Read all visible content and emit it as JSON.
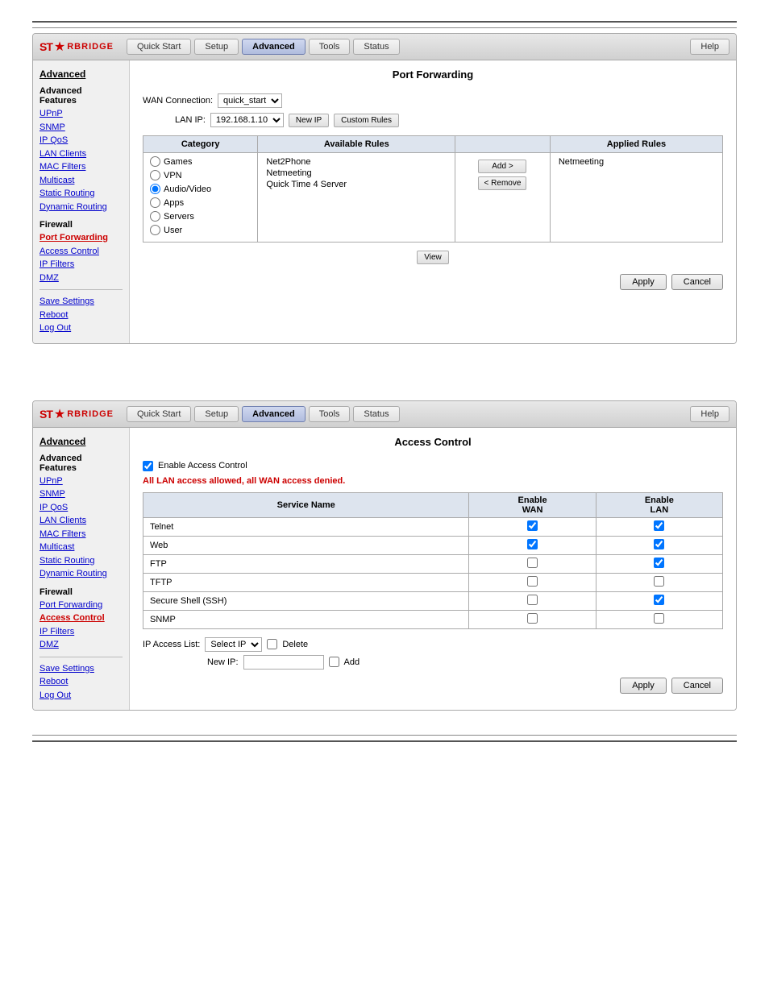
{
  "page": {
    "top_hr": true,
    "bottom_hr": true
  },
  "panel1": {
    "nav": {
      "logo_prefix": "ST",
      "logo_star": "★",
      "logo_suffix": "RBRIDGE",
      "buttons": [
        {
          "label": "Quick Start",
          "active": false
        },
        {
          "label": "Setup",
          "active": false
        },
        {
          "label": "Advanced",
          "active": true
        },
        {
          "label": "Tools",
          "active": false
        },
        {
          "label": "Status",
          "active": false
        },
        {
          "label": "Help",
          "active": false
        }
      ]
    },
    "sidebar": {
      "title": "Advanced",
      "sections": [
        {
          "title": "Advanced Features",
          "links": [
            {
              "label": "UPnP",
              "active": false
            },
            {
              "label": "SNMP",
              "active": false
            },
            {
              "label": "IP QoS",
              "active": false
            },
            {
              "label": "LAN Clients",
              "active": false
            },
            {
              "label": "MAC Filters",
              "active": false
            },
            {
              "label": "Multicast",
              "active": false
            },
            {
              "label": "Static Routing",
              "active": false
            },
            {
              "label": "Dynamic Routing",
              "active": false
            }
          ]
        },
        {
          "title": "Firewall",
          "links": [
            {
              "label": "Port Forwarding",
              "active": true
            },
            {
              "label": "Access Control",
              "active": false
            },
            {
              "label": "IP Filters",
              "active": false
            },
            {
              "label": "DMZ",
              "active": false
            }
          ]
        },
        {
          "title": "",
          "links": [
            {
              "label": "Save Settings",
              "active": false
            },
            {
              "label": "Reboot",
              "active": false
            },
            {
              "label": "Log Out",
              "active": false
            }
          ]
        }
      ]
    },
    "content": {
      "title": "Port Forwarding",
      "wan_label": "WAN Connection:",
      "wan_value": "quick_start",
      "lan_label": "LAN IP:",
      "lan_value": "192.168.1.10",
      "new_ip_btn": "New IP",
      "custom_rules_btn": "Custom Rules",
      "table": {
        "headers": [
          "Category",
          "Available Rules",
          "",
          "Applied Rules"
        ],
        "categories": [
          {
            "label": "Games",
            "selected": false
          },
          {
            "label": "VPN",
            "selected": false
          },
          {
            "label": "Audio/Video",
            "selected": true
          },
          {
            "label": "Apps",
            "selected": false
          },
          {
            "label": "Servers",
            "selected": false
          },
          {
            "label": "User",
            "selected": false
          }
        ],
        "available_rules": [
          "Net2Phone",
          "Netmeeting",
          "Quick Time 4 Server"
        ],
        "applied_rules": [
          "Netmeeting"
        ],
        "add_btn": "Add >",
        "remove_btn": "< Remove"
      },
      "view_btn": "View",
      "apply_btn": "Apply",
      "cancel_btn": "Cancel"
    }
  },
  "panel2": {
    "nav": {
      "logo_prefix": "ST",
      "logo_star": "★",
      "logo_suffix": "RBRIDGE",
      "buttons": [
        {
          "label": "Quick Start",
          "active": false
        },
        {
          "label": "Setup",
          "active": false
        },
        {
          "label": "Advanced",
          "active": true
        },
        {
          "label": "Tools",
          "active": false
        },
        {
          "label": "Status",
          "active": false
        },
        {
          "label": "Help",
          "active": false
        }
      ]
    },
    "sidebar": {
      "title": "Advanced",
      "sections": [
        {
          "title": "Advanced Features",
          "links": [
            {
              "label": "UPnP",
              "active": false
            },
            {
              "label": "SNMP",
              "active": false
            },
            {
              "label": "IP QoS",
              "active": false
            },
            {
              "label": "LAN Clients",
              "active": false
            },
            {
              "label": "MAC Filters",
              "active": false
            },
            {
              "label": "Multicast",
              "active": false
            },
            {
              "label": "Static Routing",
              "active": false
            },
            {
              "label": "Dynamic Routing",
              "active": false
            }
          ]
        },
        {
          "title": "Firewall",
          "links": [
            {
              "label": "Port Forwarding",
              "active": false
            },
            {
              "label": "Access Control",
              "active": true
            },
            {
              "label": "IP Filters",
              "active": false
            },
            {
              "label": "DMZ",
              "active": false
            }
          ]
        },
        {
          "title": "",
          "links": [
            {
              "label": "Save Settings",
              "active": false
            },
            {
              "label": "Reboot",
              "active": false
            },
            {
              "label": "Log Out",
              "active": false
            }
          ]
        }
      ]
    },
    "content": {
      "title": "Access Control",
      "enable_label": "Enable Access Control",
      "warning": "All LAN access allowed, all WAN access denied.",
      "table": {
        "headers": [
          "Service Name",
          "Enable WAN",
          "Enable LAN"
        ],
        "services": [
          {
            "name": "Telnet",
            "wan": true,
            "lan": true
          },
          {
            "name": "Web",
            "wan": true,
            "lan": true
          },
          {
            "name": "FTP",
            "wan": false,
            "lan": true
          },
          {
            "name": "TFTP",
            "wan": false,
            "lan": false
          },
          {
            "name": "Secure Shell (SSH)",
            "wan": false,
            "lan": true
          },
          {
            "name": "SNMP",
            "wan": false,
            "lan": false
          }
        ]
      },
      "ip_access_label": "IP Access List:",
      "ip_access_value": "Select IP",
      "delete_label": "Delete",
      "new_ip_label": "New IP:",
      "add_label": "Add",
      "apply_btn": "Apply",
      "cancel_btn": "Cancel"
    }
  }
}
